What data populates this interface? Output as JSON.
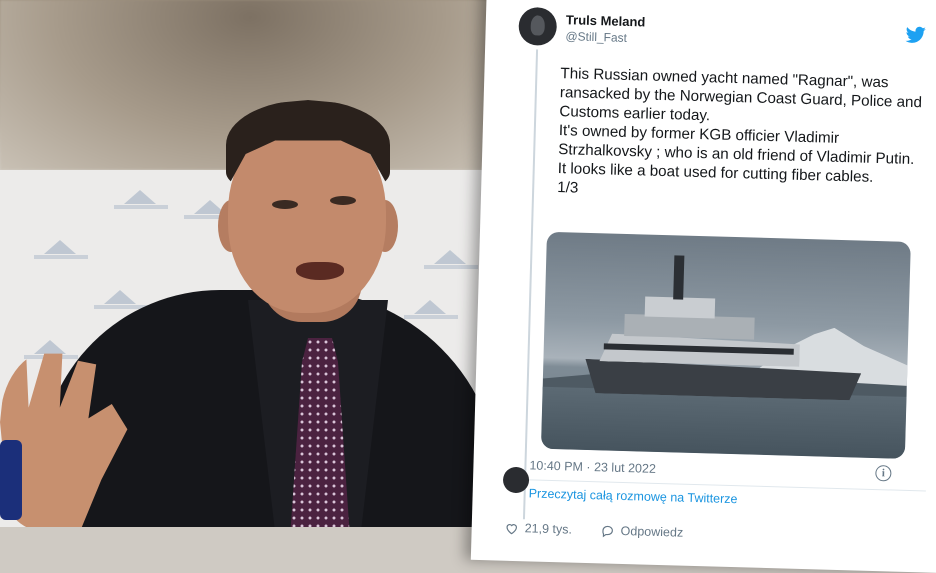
{
  "tweet": {
    "author_name": "Truls Meland",
    "author_handle": "@Still_Fast",
    "paragraphs": [
      "This Russian owned yacht named \"Ragnar\", was ransacked by the Norwegian Coast Guard, Police and Customs earlier today.",
      "It's owned by former KGB officier Vladimir Strzhalkovsky ; who is an old friend of Vladimir Putin.",
      "It looks like a boat used for cutting fiber cables.",
      "1/3"
    ],
    "timestamp": "10:40 PM · 23 lut 2022",
    "continue_label": "Przeczytaj całą rozmowę na Twitterze",
    "likes": "21,9 tys.",
    "reply_label": "Odpowiedz"
  },
  "icons": {
    "platform": "twitter-bird-icon",
    "info": "info-icon",
    "like": "heart-icon",
    "reply": "reply-icon"
  },
  "colors": {
    "twitter_blue": "#1da1f2",
    "link_blue": "#1b95e0",
    "muted_text": "#657786"
  }
}
